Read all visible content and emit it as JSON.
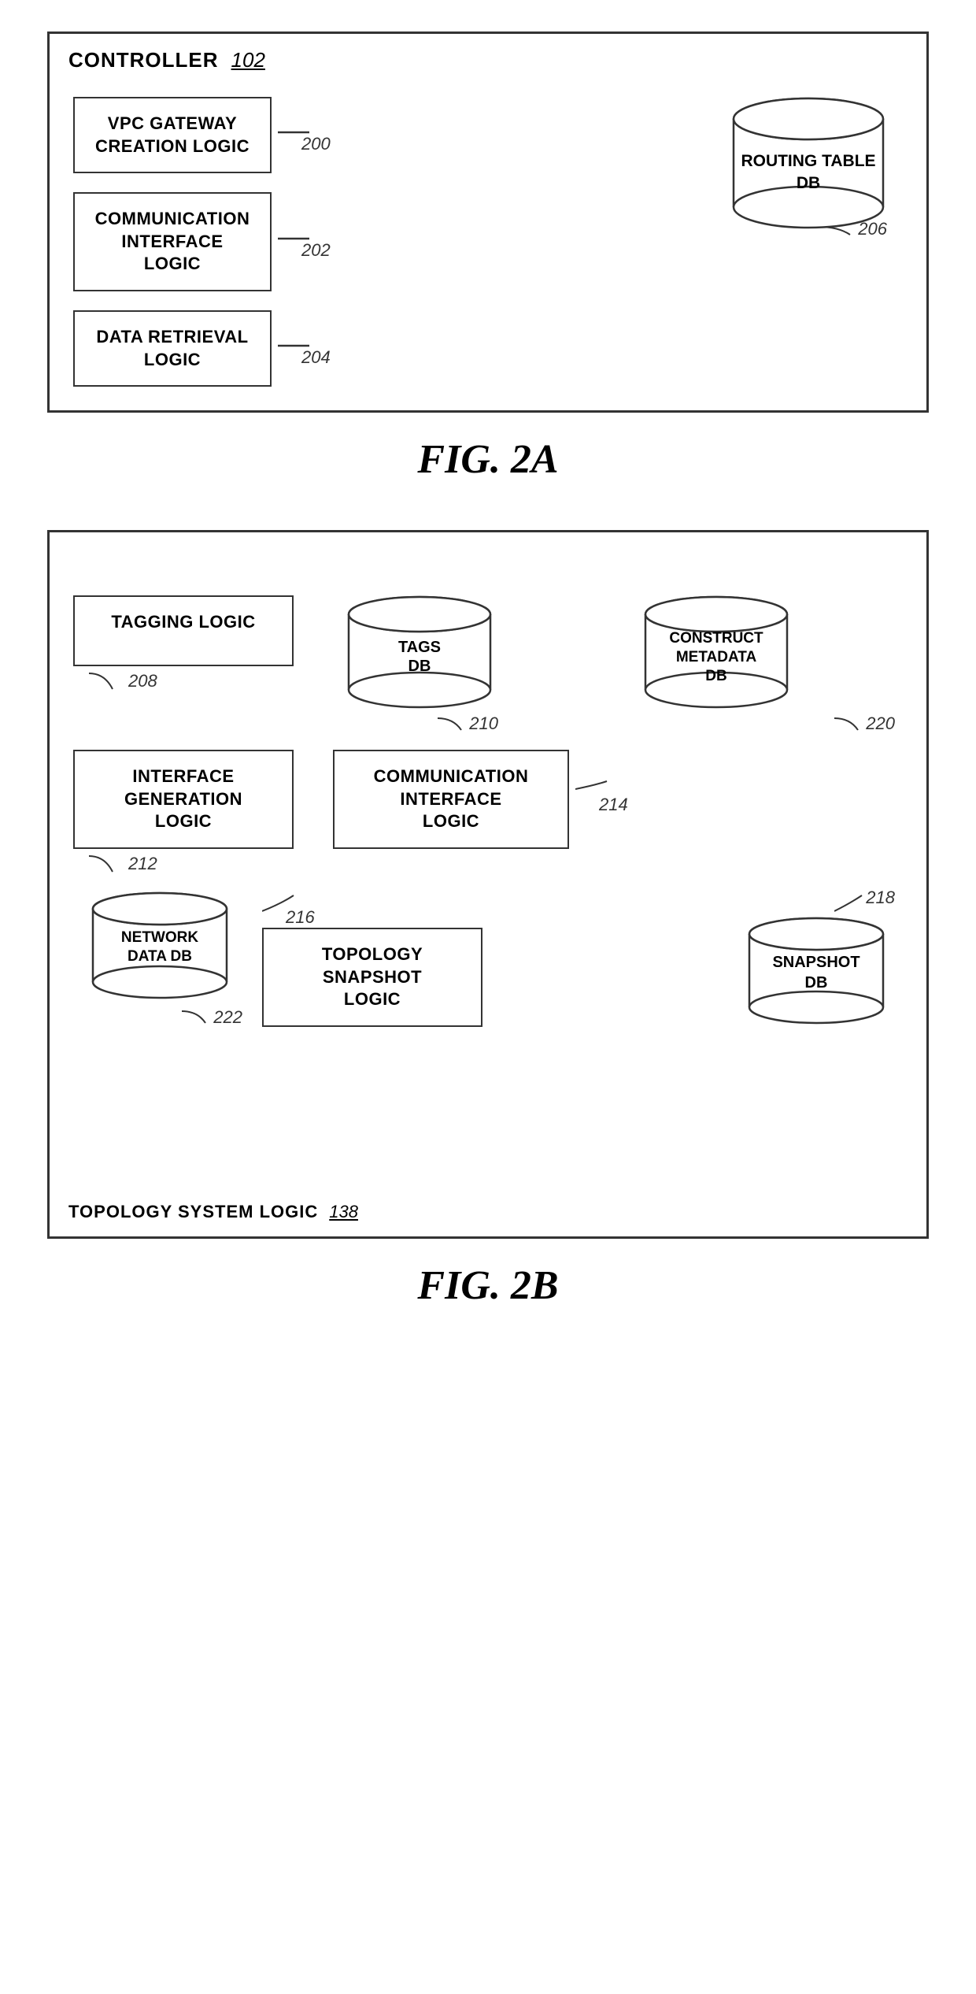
{
  "fig2a": {
    "title": "CONTROLLER",
    "title_ref": "102",
    "caption": "FIG. 2A",
    "boxes": [
      {
        "id": "vpc-gateway",
        "label": "VPC GATEWAY\nCREATION LOGIC",
        "ref": "200"
      },
      {
        "id": "comm-interface",
        "label": "COMMUNICATION\nINTERFACE LOGIC",
        "ref": "202"
      },
      {
        "id": "data-retrieval",
        "label": "DATA RETRIEVAL\nLOGIC",
        "ref": "204"
      }
    ],
    "db": {
      "label": "ROUTING TABLE\nDB",
      "ref": "206"
    }
  },
  "fig2b": {
    "title": "TOPOLOGY SYSTEM LOGIC",
    "title_ref": "138",
    "caption": "FIG. 2B",
    "row1": [
      {
        "id": "tagging-logic",
        "type": "box",
        "label": "TAGGING LOGIC",
        "ref": "208"
      },
      {
        "id": "tags-db",
        "type": "cylinder",
        "label": "TAGS\nDB",
        "ref": "210"
      },
      {
        "id": "construct-metadata-db",
        "type": "cylinder",
        "label": "CONSTRUCT\nMETADATA\nDB",
        "ref": "220"
      }
    ],
    "row2": [
      {
        "id": "interface-gen",
        "type": "box",
        "label": "INTERFACE\nGENERATION\nLOGIC",
        "ref": "212"
      },
      {
        "id": "comm-interface",
        "type": "box",
        "label": "COMMUNICATION\nINTERFACE\nLOGIC",
        "ref": "214"
      }
    ],
    "row3": [
      {
        "id": "network-data-db",
        "type": "cylinder",
        "label": "NETWORK\nDATA DB",
        "ref": "222"
      },
      {
        "id": "topology-snapshot",
        "type": "box",
        "label": "TOPOLOGY\nSNAPSHOT\nLOGIC",
        "ref": "216"
      },
      {
        "id": "snapshot-db",
        "type": "cylinder",
        "label": "SNAPSHOT\nDB",
        "ref": "218"
      }
    ]
  }
}
